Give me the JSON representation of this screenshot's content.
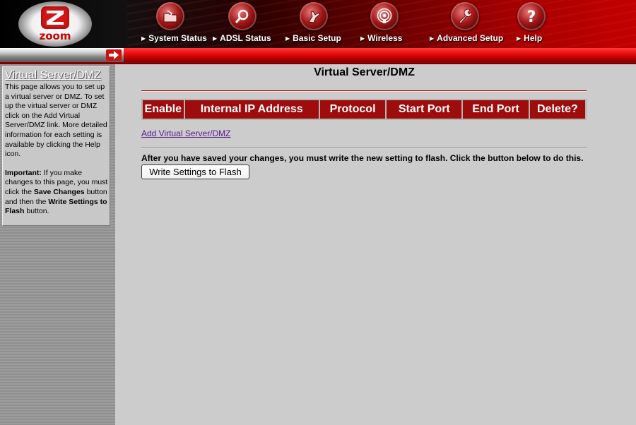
{
  "brand": {
    "logo_text": "zoom"
  },
  "nav": {
    "items": [
      {
        "label": "System Status",
        "icon": "folder-icon"
      },
      {
        "label": "ADSL Status",
        "icon": "magnifier-icon"
      },
      {
        "label": "Basic Setup",
        "icon": "hand-icon"
      },
      {
        "label": "Wireless",
        "icon": "wireless-icon"
      },
      {
        "label": "Advanced Setup",
        "icon": "wrench-icon"
      },
      {
        "label": "Help",
        "icon": "question-icon"
      }
    ]
  },
  "sidebar": {
    "title": "Virtual Server/DMZ",
    "paragraph1": "This page allows you to set up a virtual server or DMZ. To set up the virtual server or DMZ click on the Add Virtual Server/DMZ link. More detailed information for each setting is available by clicking the Help icon.",
    "important_label": "Important:",
    "important_text1": " If you make changes to this page, you must click the ",
    "save_changes": "Save Changes",
    "important_text2": " button and then the ",
    "write_settings": "Write Settings to Flash",
    "important_text3": " button."
  },
  "main": {
    "title": "Virtual Server/DMZ",
    "table": {
      "headers": [
        "Enable",
        "Internal IP Address",
        "Protocol",
        "Start Port",
        "End Port",
        "Delete?"
      ],
      "rows": []
    },
    "add_link": "Add Virtual Server/DMZ",
    "flash_note": "After you have saved your changes, you must write the new setting to flash. Click the button below to do this.",
    "flash_button": "Write Settings to Flash"
  },
  "colors": {
    "accent_red": "#9e0c0c",
    "background": "#cccccc",
    "link": "#551a8b"
  }
}
